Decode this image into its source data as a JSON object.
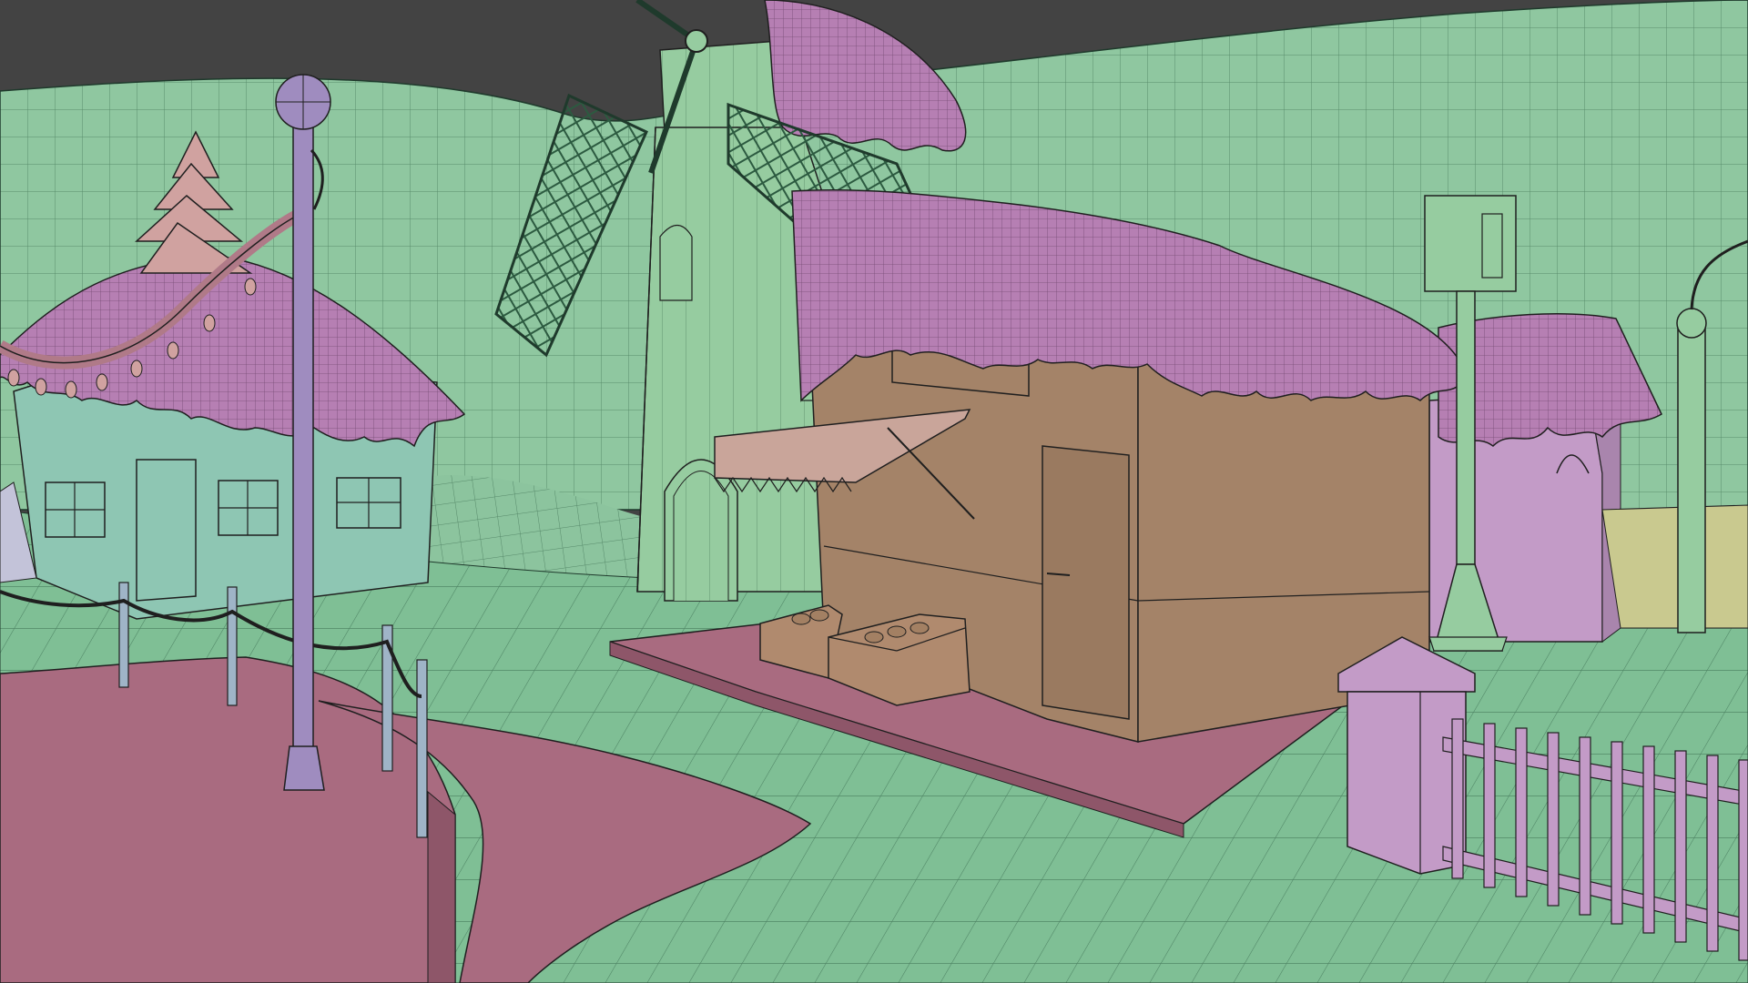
{
  "viewport": {
    "background": "#434343",
    "wire_color": "#1f3a2c",
    "colors": {
      "terrain": "#8fc7a0",
      "terrain_dark": "#7fb892",
      "roof": "#b67fb3",
      "path": "#a96b80",
      "wood": "#a48368",
      "post": "#9f8cbf",
      "pink_wall": "#c39bc7",
      "mill": "#96cca0",
      "tree": "#d0a2a0",
      "yellow_wall": "#c9c98f",
      "awning": "#c9a59a"
    },
    "objects": [
      "background-hills",
      "ground-plane",
      "path-left",
      "path-right",
      "market-platform",
      "windmill",
      "left-cottage",
      "market-stall",
      "right-booth",
      "produce-crates",
      "lamp-post-left",
      "lamp-post-center",
      "lamp-post-right",
      "rope-barrier",
      "gate-pillar",
      "picket-fence",
      "festoon-garland",
      "pine-tree"
    ]
  }
}
